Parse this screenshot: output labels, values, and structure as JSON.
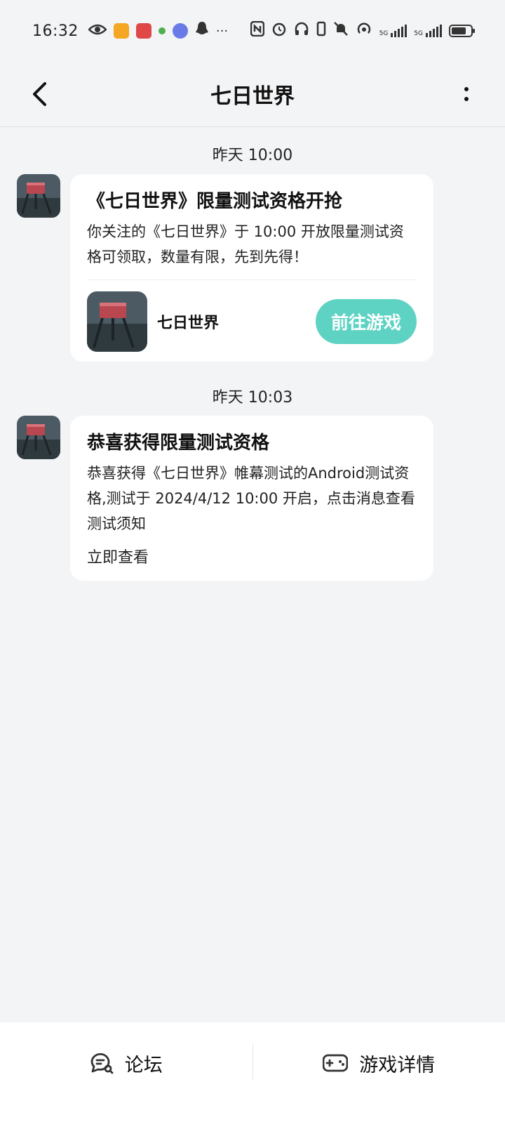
{
  "status_bar": {
    "time": "16:32",
    "left_icons": [
      "eye-icon",
      "weibo-icon",
      "huawei-icon",
      "wechat-icon",
      "music-icon",
      "qq-icon"
    ],
    "more": "···",
    "right_icons": [
      "nfc-icon",
      "alarm-icon",
      "headset-icon",
      "vibrate-icon",
      "mute-icon",
      "hotspot-icon"
    ],
    "signal_label_1": "5G",
    "signal_label_2": "5G"
  },
  "header": {
    "title": "七日世界"
  },
  "messages": [
    {
      "timestamp": "昨天  10:00",
      "title": "《七日世界》限量测试资格开抢",
      "body": "你关注的《七日世界》于 10:00 开放限量测试资格可领取，数量有限，先到先得！",
      "game_name": "七日世界",
      "action_label": "前往游戏"
    },
    {
      "timestamp": "昨天  10:03",
      "title": "恭喜获得限量测试资格",
      "body": "恭喜获得《七日世界》帷幕测试的Android测试资格,测试于 2024/4/12 10:00 开启，点击消息查看测试须知",
      "link_label": "立即查看"
    }
  ],
  "bottom_bar": {
    "forum_label": "论坛",
    "details_label": "游戏详情"
  },
  "colors": {
    "accent": "#5ed3c3",
    "background": "#f3f4f6"
  }
}
